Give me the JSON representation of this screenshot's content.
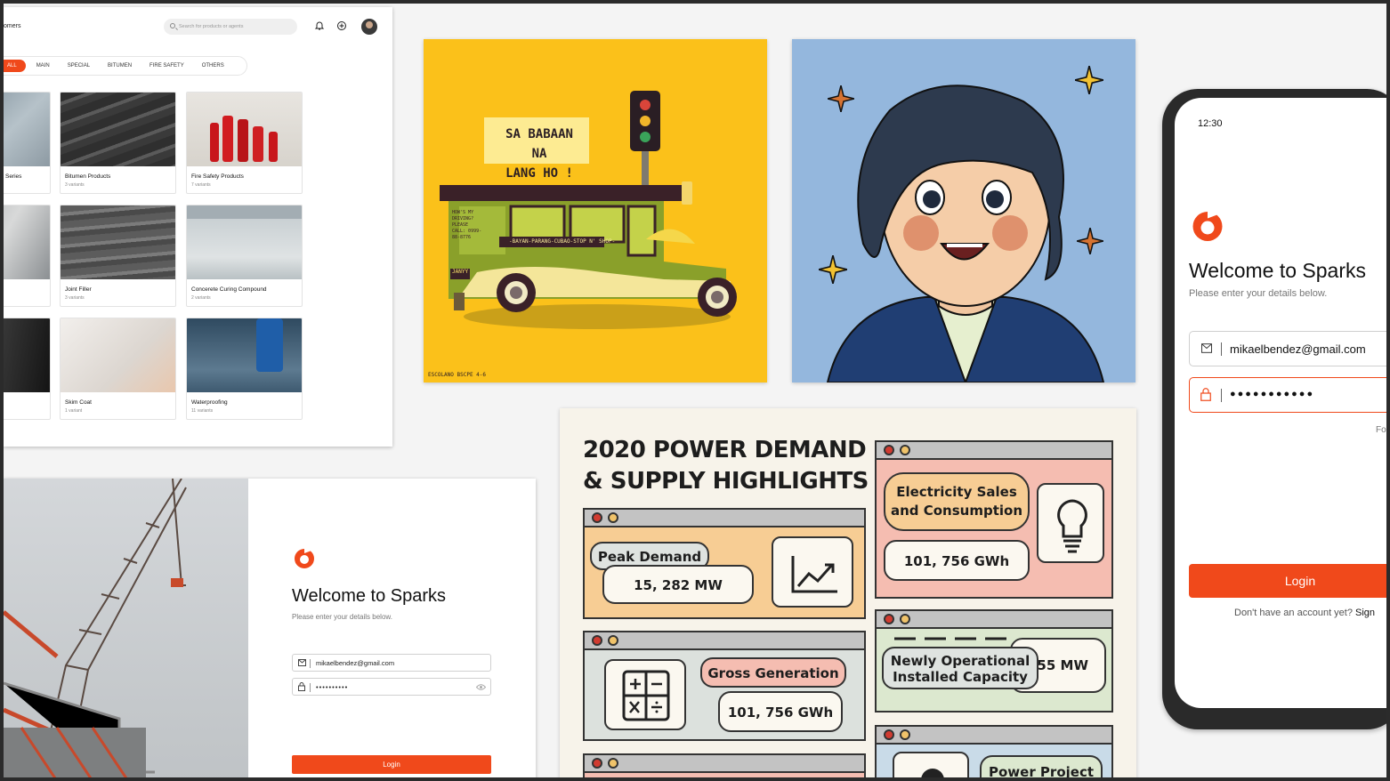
{
  "catalog": {
    "title_partial": "omers",
    "search_placeholder": "Search for products or agents",
    "chips": [
      "ALL",
      "MAIN",
      "SPECIAL",
      "BITUMEN",
      "FIRE SAFETY",
      "OTHERS"
    ],
    "products": [
      {
        "name": "Series",
        "variants": ""
      },
      {
        "name": "Bitumen Products",
        "variants": "3 variants"
      },
      {
        "name": "Fire Safety Products",
        "variants": "7 variants"
      },
      {
        "name": "",
        "variants": ""
      },
      {
        "name": "Joint Filler",
        "variants": "3 variants"
      },
      {
        "name": "Concerete Curing Compound",
        "variants": "2 variants"
      },
      {
        "name": "",
        "variants": ""
      },
      {
        "name": "Skim Coat",
        "variants": "1 variant"
      },
      {
        "name": "Waterproofing",
        "variants": "11 variants"
      }
    ]
  },
  "login_desktop": {
    "title": "Welcome to Sparks",
    "subtitle": "Please enter your details below.",
    "email": "mikaelbendez@gmail.com",
    "password": "••••••••••",
    "button": "Login"
  },
  "jeep_art": {
    "sign_line1": "SA BABAAN NA",
    "sign_line2": "LANG HO !",
    "route": "-BAYAN-PARANG-CUBAO-STOP N' SHOP-",
    "side_note": "HOW'S MY DRIVING? PLEASE CALL: 0999-88-8776",
    "plate": "JANYY",
    "credit": "ESCOLANO BSCPE 4-6"
  },
  "infographic": {
    "title_line1": "2020 POWER DEMAND",
    "title_line2": "& SUPPLY HIGHLIGHTS",
    "peak_label": "Peak Demand",
    "peak_value": "15, 282 MW",
    "sales_label_1": "Electricity Sales",
    "sales_label_2": "and Consumption",
    "sales_value": "101, 756 GWh",
    "gross_label": "Gross Generation",
    "gross_value": "101, 756 GWh",
    "capacity_label_1": "Newly Operational",
    "capacity_label_2": "Installed Capacity",
    "capacity_value": "655 MW",
    "project_label": "Power Project"
  },
  "phone": {
    "time": "12:30",
    "title": "Welcome to Sparks",
    "subtitle": "Please enter your details below.",
    "email": "mikaelbendez@gmail.com",
    "password": "●●●●●●●●●●●",
    "forgot_partial": "Fo",
    "button": "Login",
    "signup_text": "Don't have an account yet?",
    "signup_link_partial": "Sign"
  },
  "colors": {
    "accent": "#f0491b",
    "jeep_bg": "#fbc11a",
    "anime_bg": "#94b7dd",
    "info_bg": "#f7f3ea"
  }
}
